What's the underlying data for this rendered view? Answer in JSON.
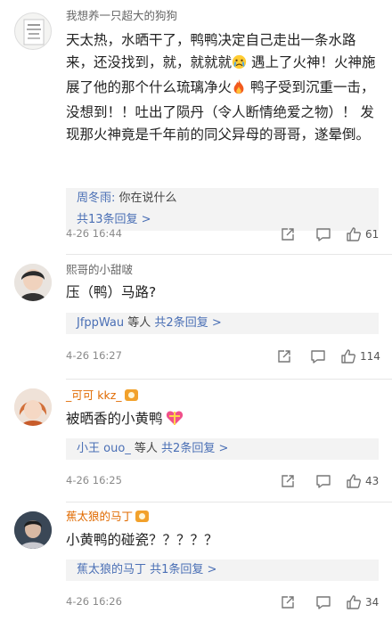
{
  "comments": [
    {
      "username": "我想养一只超大的狗狗",
      "text_parts": [
        "天太热，水晒干了，鸭鸭决定自己走出一条水路来，还没找到，就，就就就",
        "遇上了火神！火神施展了他的那个什么琉璃净火",
        "鸭子受到沉重一击，没想到！！吐出了陨丹（令人断情绝爱之物）！ 发现那火神竟是千年前的同父异母的哥哥，遂晕倒。"
      ],
      "reply_preview": {
        "name": "周冬雨:",
        "text": " 你在说什么"
      },
      "reply_count": "共13条回复 >",
      "time": "4-26 16:44",
      "likes": "61"
    },
    {
      "username": "熙哥的小甜啵",
      "text": "压（鸭）马路?",
      "reply_user": "JfppWau",
      "reply_mid": " 等人 ",
      "reply_count": "共2条回复 >",
      "time": "4-26 16:27",
      "likes": "114"
    },
    {
      "username": "_可可 kkz_",
      "text": "被晒香的小黄鸭",
      "reply_user": "小王 ouo_",
      "reply_mid": " 等人 ",
      "reply_count": "共2条回复 >",
      "time": "4-26 16:25",
      "likes": "43"
    },
    {
      "username": "蕉太狼的马丁",
      "text": "小黄鸭的碰瓷？？？？？",
      "reply_user": "蕉太狼的马丁",
      "reply_count": "共1条回复 >",
      "time": "4-26 16:26",
      "likes": "34"
    }
  ],
  "colors": {
    "link": "#4a6fb5",
    "orange_name": "#e06a00",
    "reply_bg": "#f3f3f3"
  },
  "icons": [
    "share-icon",
    "comment-icon",
    "like-icon",
    "crying-face-emoji",
    "fire-emoji",
    "gift-heart-emoji",
    "vip-badge-icon"
  ]
}
